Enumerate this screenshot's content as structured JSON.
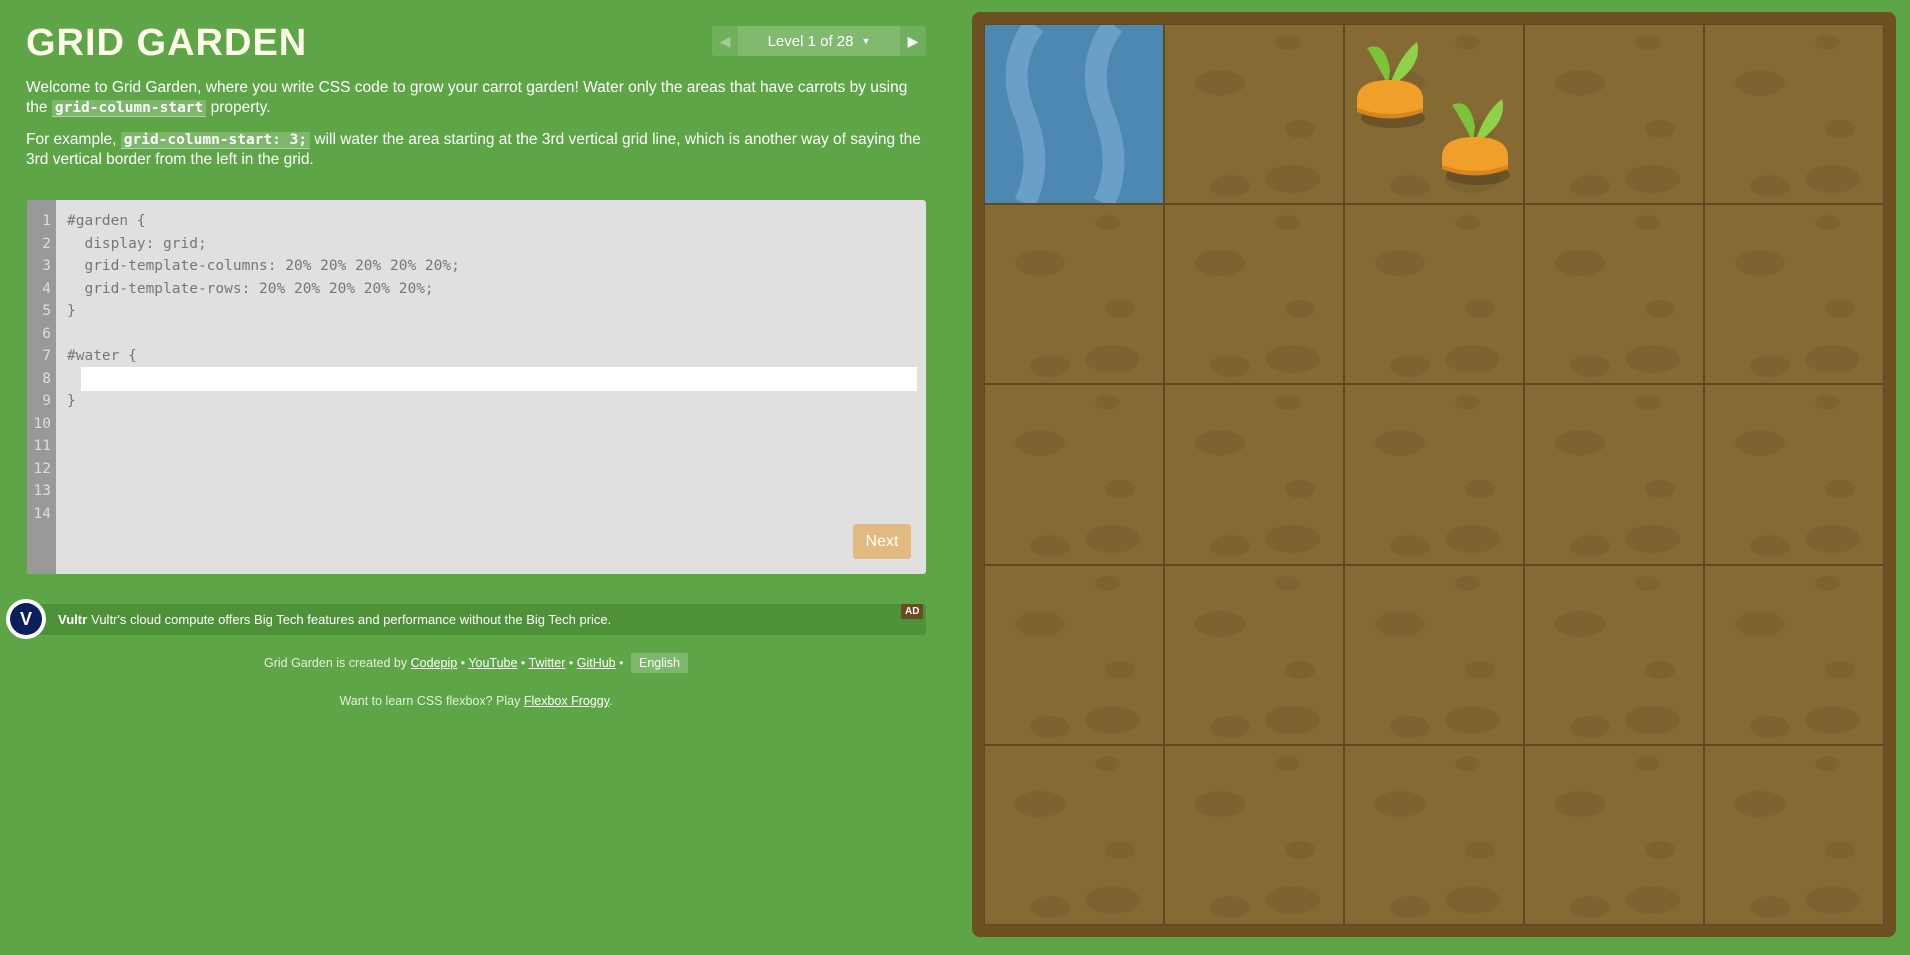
{
  "header": {
    "title": "GRID GARDEN",
    "level_label": "Level 1 of 28",
    "prev_icon": "triangle-left-icon",
    "next_icon": "triangle-right-icon",
    "dropdown_icon": "caret-down-icon"
  },
  "instructions": {
    "p1_before": "Welcome to Grid Garden, where you write CSS code to grow your carrot garden! Water only the areas that have carrots by using the ",
    "p1_code": "grid-column-start",
    "p1_after": " property.",
    "p2_before": "For example, ",
    "p2_code": "grid-column-start: 3;",
    "p2_after": " will water the area starting at the 3rd vertical grid line, which is another way of saying the 3rd vertical border from the left in the grid."
  },
  "editor": {
    "line_numbers": [
      "1",
      "2",
      "3",
      "4",
      "5",
      "6",
      "7",
      "8",
      "9",
      "10",
      "11",
      "12",
      "13",
      "14"
    ],
    "lines": [
      "#garden {",
      "  display: grid;",
      "  grid-template-columns: 20% 20% 20% 20% 20%;",
      "  grid-template-rows: 20% 20% 20% 20% 20%;",
      "}",
      "",
      "#water {",
      "",
      "}"
    ],
    "input_value": "",
    "next_label": "Next"
  },
  "ad": {
    "logo_letter": "V",
    "brand": "Vultr",
    "text": "Vultr's cloud compute offers Big Tech features and performance without the Big Tech price.",
    "tag": "AD"
  },
  "footer": {
    "credit_prefix": "Grid Garden is created by",
    "links": [
      "Codepip",
      "YouTube",
      "Twitter",
      "GitHub"
    ],
    "sep": "•",
    "language": "English",
    "flexbox_prefix": "Want to learn CSS flexbox? Play",
    "flexbox_link": "Flexbox Froggy",
    "flexbox_suffix": "."
  },
  "garden": {
    "rows": 5,
    "columns": 5,
    "water_cell": {
      "row": 1,
      "column": 1
    },
    "carrot_cells": [
      {
        "row": 1,
        "column": 3
      }
    ],
    "colors": {
      "soil": "#856a33",
      "frame": "#6d5123",
      "water": "#4d88b3",
      "carrot": "#f0a02a",
      "leaf": "#7cc33a",
      "background": "#5da546"
    }
  }
}
